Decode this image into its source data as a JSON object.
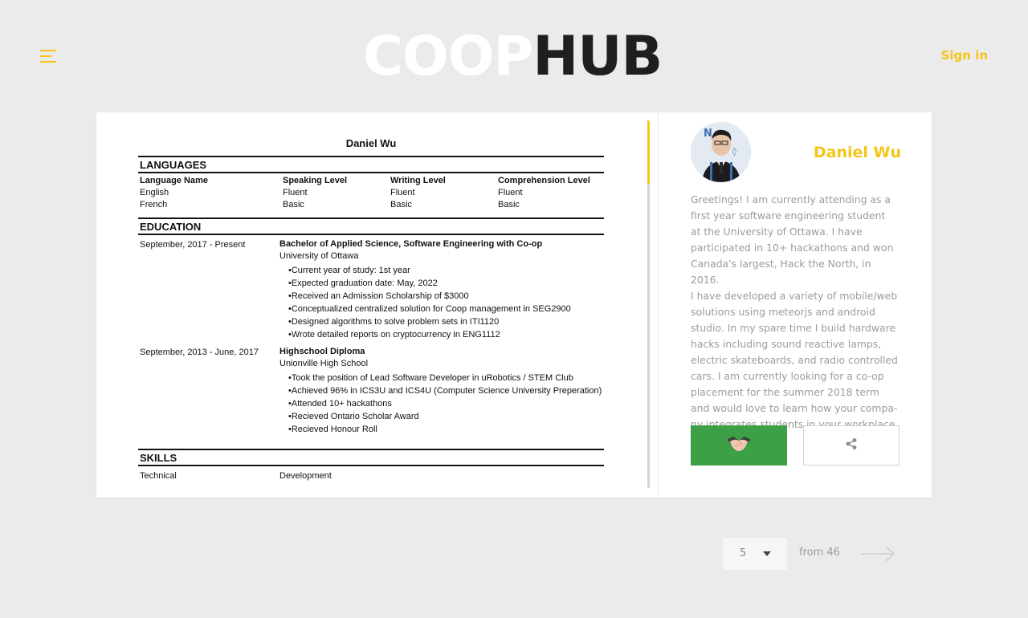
{
  "header": {
    "logo_part1": "COOP",
    "logo_part2": "HUB",
    "signin_label": "Sign in"
  },
  "resume": {
    "name": "Daniel Wu",
    "languages": {
      "title": "LANGUAGES",
      "headers": [
        "Language Name",
        "Speaking Level",
        "Writing Level",
        "Comprehension Level"
      ],
      "rows": [
        [
          "English",
          "Fluent",
          "Fluent",
          "Fluent"
        ],
        [
          "French",
          "Basic",
          "Basic",
          "Basic"
        ]
      ]
    },
    "education": {
      "title": "EDUCATION",
      "entries": [
        {
          "date": "September, 2017 - Present",
          "title": "Bachelor of Applied Science, Software Engineering with Co-op",
          "school": "University of Ottawa",
          "bullets": [
            "•Current year of study: 1st year",
            "•Expected graduation date: May, 2022",
            "•Received an Admission Scholarship of $3000",
            "•Conceptualized centralized solution for Coop management in SEG2900",
            "•Designed algorithms to solve problem sets in ITI1120",
            "•Wrote detailed reports on cryptocurrency in ENG1112"
          ]
        },
        {
          "date": "September, 2013 - June, 2017",
          "title": "Highschool Diploma",
          "school": "Unionville High School",
          "bullets": [
            "•Took the position of Lead Software Developer in uRobotics / STEM Club",
            "•Achieved 96% in ICS3U and ICS4U (Computer Science University Preperation)",
            "•Attended 10+ hackathons",
            "•Recieved Ontario Scholar Award",
            "•Recieved Honour Roll"
          ]
        }
      ]
    },
    "skills": {
      "title": "SKILLS",
      "row": [
        "Technical",
        "Development"
      ]
    }
  },
  "profile": {
    "name": "Daniel Wu",
    "bio_lines": [
      "Greetings! I am currently attending as a",
      "first year software engineering student",
      "at the University of Ottawa. I have",
      "participated in 10+ hackathons and won",
      "Canada's largest, Hack the North, in 2016.",
      "I have developed a variety of mobile/web",
      "solutions using meteorjs and android",
      "studio. In my spare time I build hardware",
      "hacks including sound reactive lamps,",
      "electric skateboards, and radio controlled",
      "cars. I am currently looking for a co-op",
      "placement for the summer 2018 term",
      "and would love to learn how your compa-",
      "ny integrates students in your workplace."
    ],
    "accept_icon": "handshake-icon",
    "share_icon": "share-icon"
  },
  "pagination": {
    "current": "5",
    "total_label": "from 46",
    "next_icon": "arrow-right-icon"
  },
  "colors": {
    "accent": "#f5c518",
    "accept_green": "#3da046",
    "background": "#ebebeb"
  }
}
